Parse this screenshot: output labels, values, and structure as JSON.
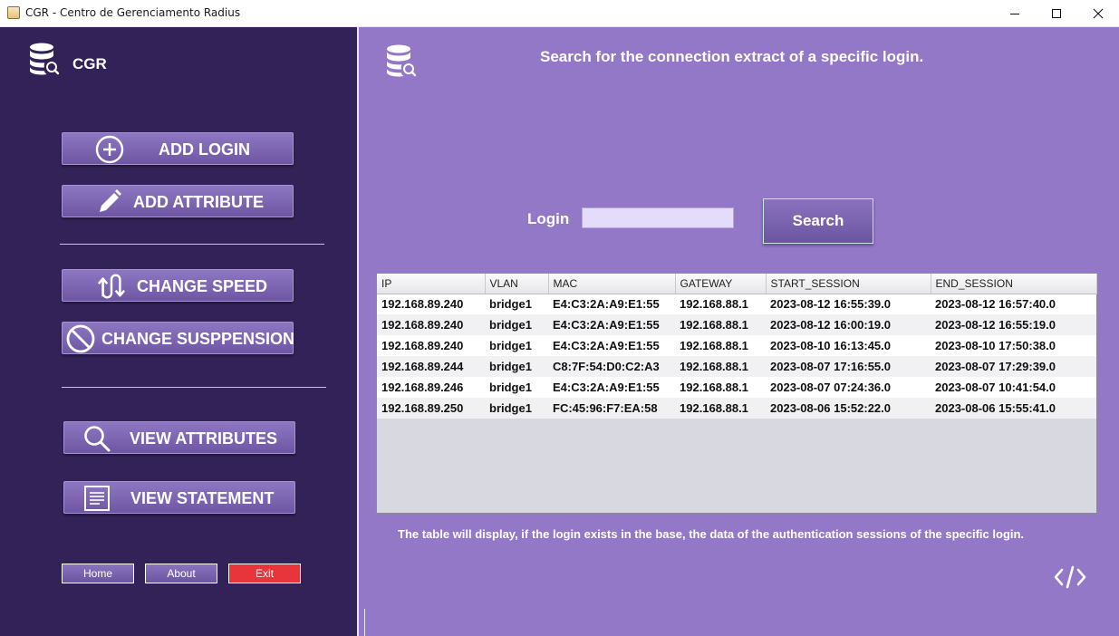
{
  "window": {
    "title": "CGR - Centro de Gerenciamento Radius"
  },
  "sidebar": {
    "brand": "CGR",
    "buttons": {
      "add_login": "ADD LOGIN",
      "add_attribute": "ADD ATTRIBUTE",
      "change_speed": "CHANGE SPEED",
      "change_suspension": "CHANGE SUSPPENSION",
      "view_attributes": "VIEW ATTRIBUTES",
      "view_statement": "VIEW STATEMENT"
    },
    "footer": {
      "home": "Home",
      "about": "About",
      "exit": "Exit"
    }
  },
  "main": {
    "title": "Search for the connection extract of a specific login.",
    "login_label": "Login",
    "login_value": "",
    "search_label": "Search",
    "note": "The table will display, if the login exists in the base, the data of the authentication sessions of the specific login."
  },
  "table": {
    "columns": [
      "IP",
      "VLAN",
      "MAC",
      "GATEWAY",
      "START_SESSION",
      "END_SESSION"
    ],
    "rows": [
      [
        "192.168.89.240",
        "bridge1",
        "E4:C3:2A:A9:E1:55",
        "192.168.88.1",
        "2023-08-12 16:55:39.0",
        "2023-08-12 16:57:40.0"
      ],
      [
        "192.168.89.240",
        "bridge1",
        "E4:C3:2A:A9:E1:55",
        "192.168.88.1",
        "2023-08-12 16:00:19.0",
        "2023-08-12 16:55:19.0"
      ],
      [
        "192.168.89.240",
        "bridge1",
        "E4:C3:2A:A9:E1:55",
        "192.168.88.1",
        "2023-08-10 16:13:45.0",
        "2023-08-10 17:50:38.0"
      ],
      [
        "192.168.89.244",
        "bridge1",
        "C8:7F:54:D0:C2:A3",
        "192.168.88.1",
        "2023-08-07 17:16:55.0",
        "2023-08-07 17:29:39.0"
      ],
      [
        "192.168.89.246",
        "bridge1",
        "E4:C3:2A:A9:E1:55",
        "192.168.88.1",
        "2023-08-07 07:24:36.0",
        "2023-08-07 10:41:54.0"
      ],
      [
        "192.168.89.250",
        "bridge1",
        "FC:45:96:F7:EA:58",
        "192.168.88.1",
        "2023-08-06 15:52:22.0",
        "2023-08-06 15:55:41.0"
      ]
    ]
  },
  "icons": {
    "brand": "database-search-icon",
    "add_login": "plus-circle-icon",
    "add_attribute": "pencil-icon",
    "change_speed": "u-turn-arrows-icon",
    "change_suspension": "prohibited-icon",
    "view_attributes": "magnifier-icon",
    "view_statement": "document-icon",
    "code": "code-icon"
  },
  "colors": {
    "sidebar_bg": "#322257",
    "main_bg": "#9278c7",
    "exit_red": "#e8343b"
  }
}
